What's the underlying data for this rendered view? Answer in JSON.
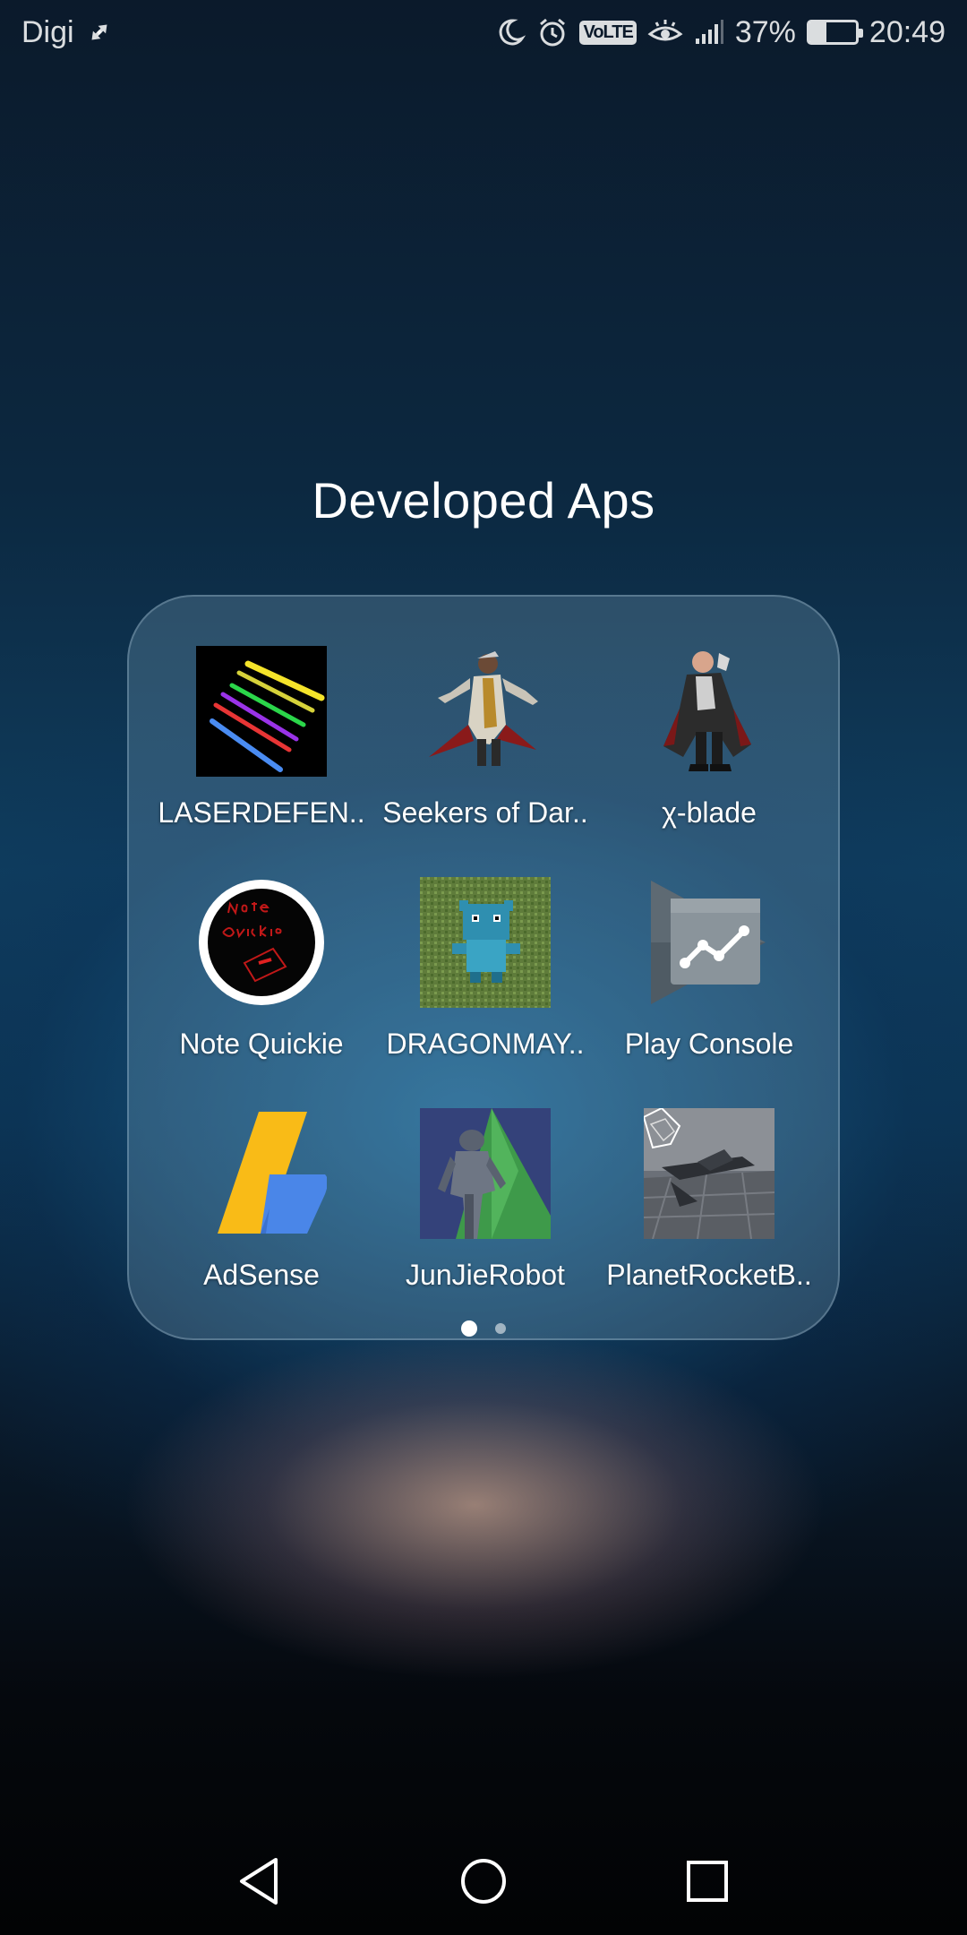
{
  "status_bar": {
    "carrier": "Digi",
    "volte": "VoLTE",
    "battery_percent": "37%",
    "battery_level": 0.37,
    "time": "20:49"
  },
  "folder": {
    "title": "Developed Aps",
    "apps": [
      {
        "label": "LASERDEFEN..",
        "icon": "laser-app-icon"
      },
      {
        "label": "Seekers of Dar..",
        "icon": "seekers-app-icon"
      },
      {
        "label": "χ-blade",
        "icon": "x-blade-app-icon"
      },
      {
        "label": "Note Quickie",
        "icon": "note-quickie-app-icon"
      },
      {
        "label": "DRAGONMAY..",
        "icon": "dragonmay-app-icon"
      },
      {
        "label": "Play Console",
        "icon": "play-console-app-icon"
      },
      {
        "label": "AdSense",
        "icon": "adsense-app-icon"
      },
      {
        "label": "JunJieRobot",
        "icon": "junjie-robot-app-icon"
      },
      {
        "label": "PlanetRocketB..",
        "icon": "planet-rocket-app-icon"
      }
    ],
    "page_count": 2,
    "current_page": 1
  },
  "colors": {
    "adsense_yellow": "#F9BB17",
    "adsense_blue": "#4A86E8",
    "play_console_gray": "#5a6670"
  }
}
